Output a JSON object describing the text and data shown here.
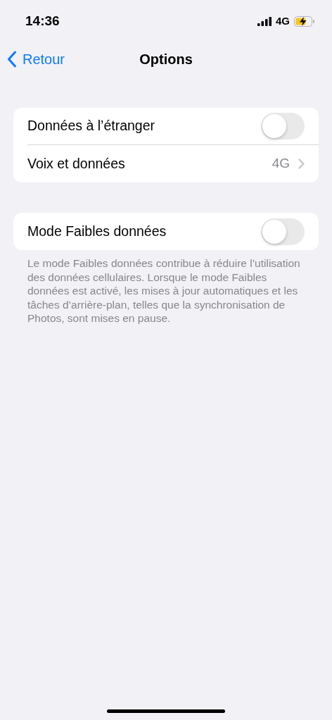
{
  "status_bar": {
    "time": "14:36",
    "network": "4G"
  },
  "nav": {
    "back": "Retour",
    "title": "Options"
  },
  "groups": [
    {
      "rows": [
        {
          "kind": "toggle",
          "label": "Données à l’étranger",
          "on": false
        },
        {
          "kind": "disclosure",
          "label": "Voix et données",
          "value": "4G"
        }
      ]
    },
    {
      "rows": [
        {
          "kind": "toggle",
          "label": "Mode Faibles données",
          "on": false
        }
      ],
      "footer": "Le mode Faibles données contribue à réduire l’utilisation des données cellulaires. Lorsque le mode Faibles données est activé, les mises à jour automatiques et les tâches d’arrière-plan, telles que la synchronisation de Photos, sont mises en pause."
    }
  ]
}
